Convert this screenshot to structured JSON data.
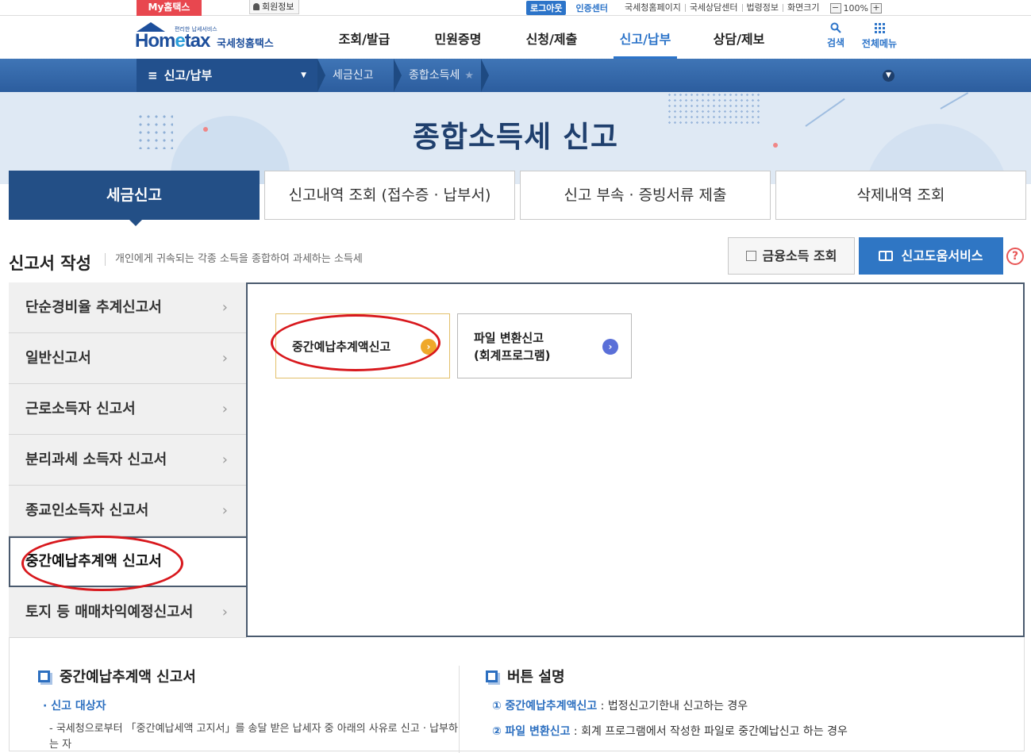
{
  "util": {
    "my_hometax": "My홈택스",
    "member_info": "회원정보",
    "logout": "로그아웃",
    "cert_center": "인증센터",
    "links": [
      "국세청홈페이지",
      "국세상담센터",
      "법령정보",
      "화면크기"
    ],
    "zoom_minus": "−",
    "zoom_value": "100%",
    "zoom_plus": "+"
  },
  "logo": {
    "tagline": "편리한 납세서비스",
    "word_a": "Hom",
    "word_e": "e",
    "word_b": "tax",
    "ko": "국세청홈택스"
  },
  "gnb": {
    "menu": [
      "조회/발급",
      "민원증명",
      "신청/제출",
      "신고/납부",
      "상담/제보"
    ],
    "active_index": 3,
    "search": "검색",
    "all_menu": "전체메뉴"
  },
  "location": {
    "menu": "신고/납부",
    "crumbs": [
      "세금신고",
      "종합소득세"
    ]
  },
  "hero": {
    "title": "종합소득세 신고"
  },
  "tabs": [
    "세금신고",
    "신고내역 조회 (접수증 · 납부서)",
    "신고 부속 · 증빙서류 제출",
    "삭제내역 조회"
  ],
  "section": {
    "title": "신고서 작성",
    "desc": "개인에게 귀속되는 각종 소득을 종합하여 과세하는 소득세",
    "btn_finance": "금융소득 조회",
    "btn_help": "신고도움서비스",
    "help_q": "?"
  },
  "side_menu": [
    "단순경비율 추계신고서",
    "일반신고서",
    "근로소득자 신고서",
    "분리과세 소득자 신고서",
    "종교인소득자 신고서",
    "중간예납추계액 신고서",
    "토지 등 매매차익예정신고서"
  ],
  "side_active_index": 5,
  "panel": {
    "btn1": "중간예납추계액신고",
    "btn2_line1": "파일 변환신고",
    "btn2_line2": "(회계프로그램)"
  },
  "info": {
    "left_title": "중간예납추계액 신고서",
    "left_sub": "· 신고 대상자",
    "left_text": "- 국세청으로부터 「중간예납세액 고지서」를 송달 받은 납세자 중 아래의 사유로 신고 · 납부하는 자",
    "right_title": "버튼 설명",
    "right_items": [
      {
        "num": "①",
        "name": "중간예납추계액신고",
        "desc": " : 법정신고기한내 신고하는 경우"
      },
      {
        "num": "②",
        "name": "파일 변환신고",
        "desc": " : 회계 프로그램에서 작성한 파일로 중간예납신고 하는 경우"
      }
    ]
  },
  "colors": {
    "brand": "#2c74c9",
    "nav_dark": "#234f86",
    "annotation": "#d8181d"
  }
}
